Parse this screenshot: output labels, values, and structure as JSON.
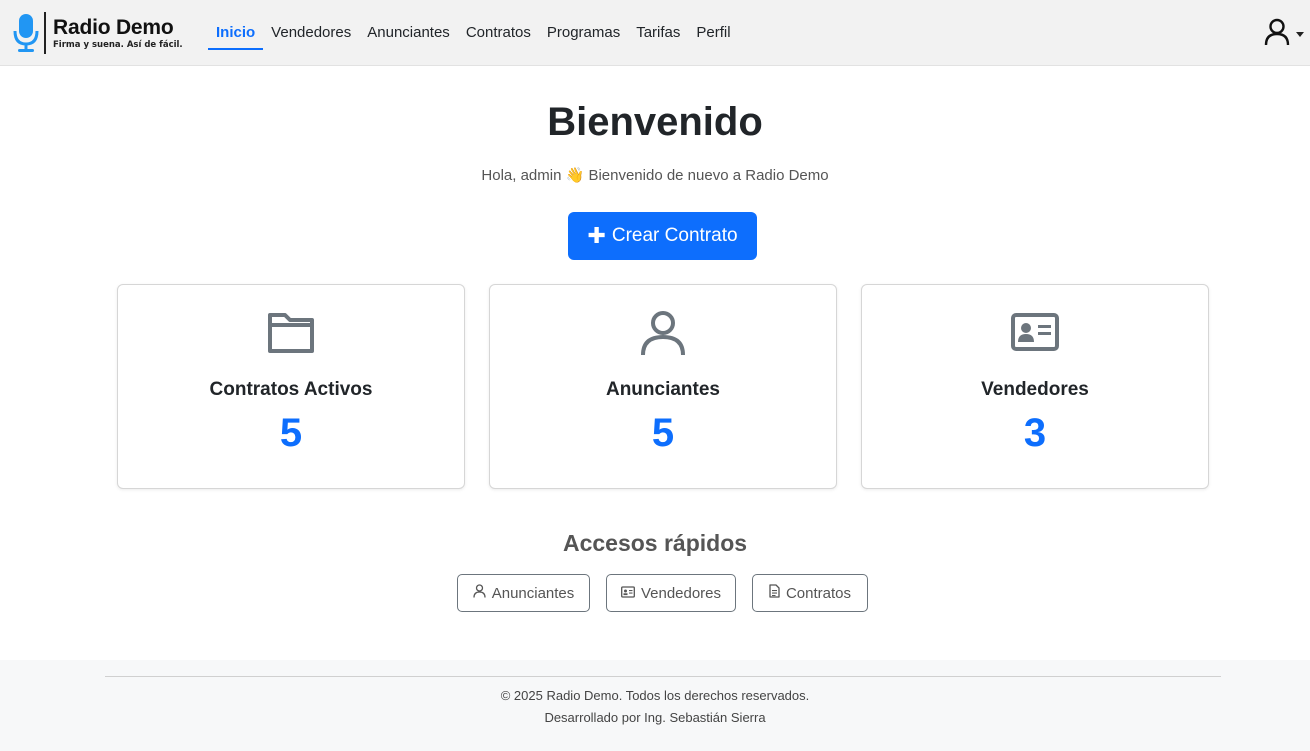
{
  "brand": {
    "name": "Radio Demo",
    "tagline": "Firma y suena. Así de fácil.",
    "accent": "#2196f3"
  },
  "nav": {
    "items": [
      {
        "label": "Inicio",
        "active": true
      },
      {
        "label": "Vendedores",
        "active": false
      },
      {
        "label": "Anunciantes",
        "active": false
      },
      {
        "label": "Contratos",
        "active": false
      },
      {
        "label": "Programas",
        "active": false
      },
      {
        "label": "Tarifas",
        "active": false
      },
      {
        "label": "Perfil",
        "active": false
      }
    ],
    "user_icon": "user-icon"
  },
  "main": {
    "title": "Bienvenido",
    "greeting": "Hola, admin 👋 Bienvenido de nuevo a Radio Demo",
    "cta_label": "Crear Contrato",
    "cta_icon": "plus-icon"
  },
  "cards": [
    {
      "icon": "folder-icon",
      "label": "Contratos Activos",
      "value": "5"
    },
    {
      "icon": "person-icon",
      "label": "Anunciantes",
      "value": "5"
    },
    {
      "icon": "id-card-icon",
      "label": "Vendedores",
      "value": "3"
    }
  ],
  "quick_access": {
    "title": "Accesos rápidos",
    "buttons": [
      {
        "icon": "person-icon",
        "label": "Anunciantes"
      },
      {
        "icon": "id-card-icon",
        "label": "Vendedores"
      },
      {
        "icon": "document-icon",
        "label": "Contratos"
      }
    ]
  },
  "footer": {
    "copyright": "© 2025 Radio Demo. Todos los derechos reservados.",
    "credit": "Desarrollado por Ing. Sebastián Sierra"
  },
  "colors": {
    "primary": "#0d6efd",
    "navbar_bg": "#f2f2f2",
    "icon_gray": "#6c757d"
  }
}
